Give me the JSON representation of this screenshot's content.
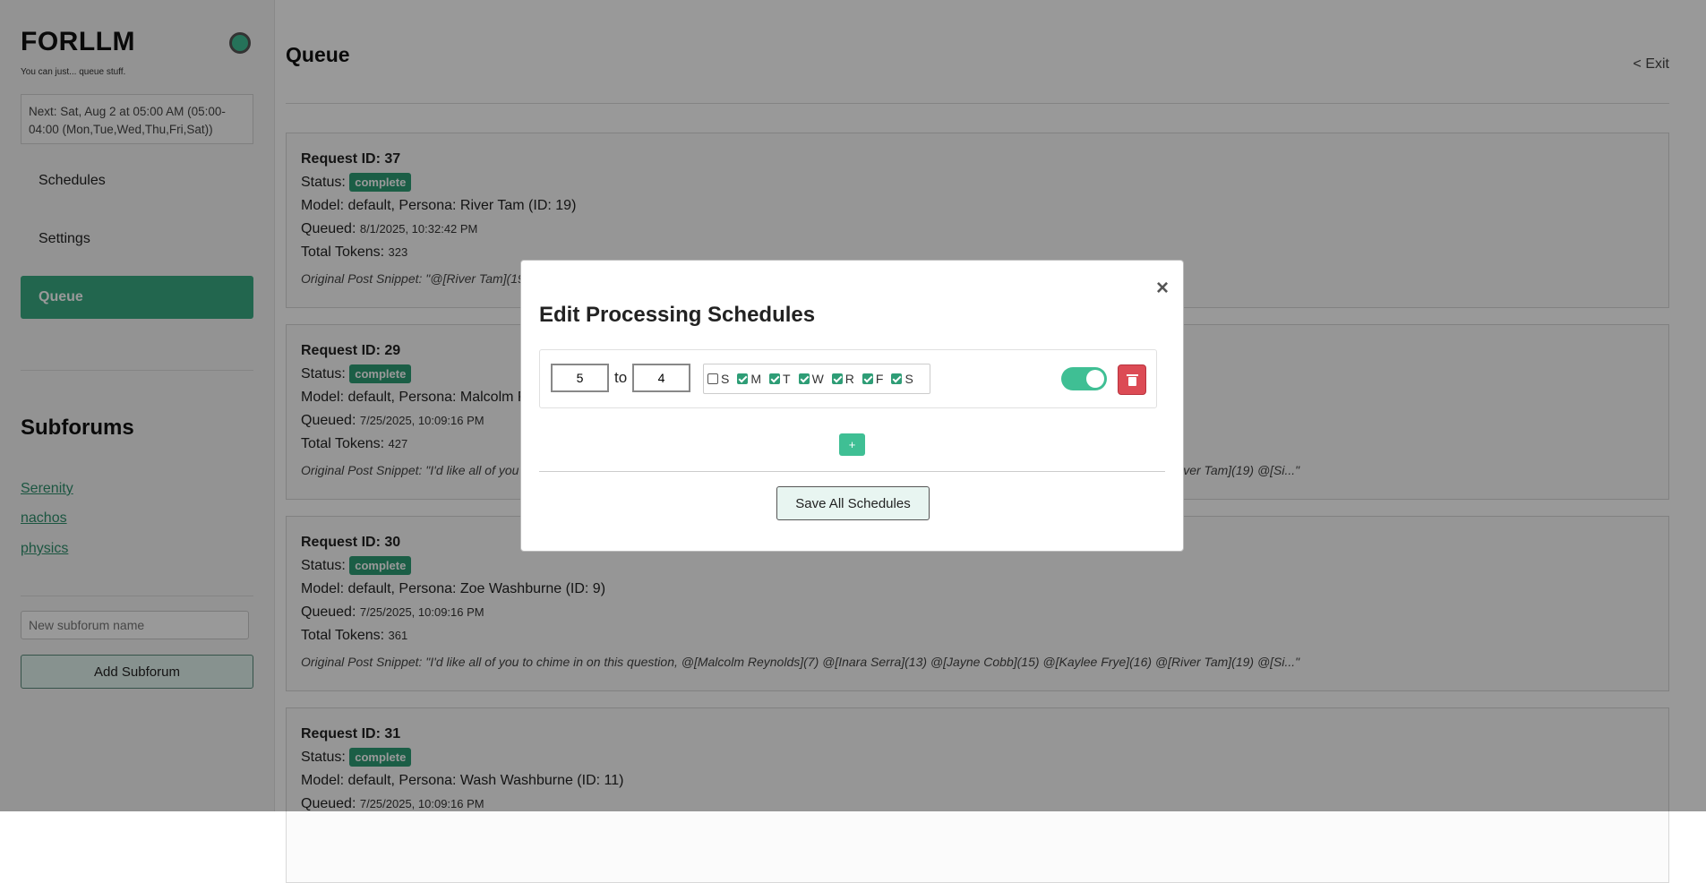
{
  "sidebar": {
    "brand": "FORLLM",
    "tagline": "You can just... queue stuff.",
    "next_run": "Next: Sat, Aug 2 at 05:00 AM (05:00-04:00 (Mon,Tue,Wed,Thu,Fri,Sat))",
    "nav": {
      "schedules": "Schedules",
      "settings": "Settings",
      "queue": "Queue"
    },
    "subforums_heading": "Subforums",
    "subforums": [
      "Serenity",
      "nachos",
      "physics"
    ],
    "new_subforum_placeholder": "New subforum name",
    "add_subforum_label": "Add Subforum"
  },
  "main": {
    "title": "Queue",
    "exit_label": "< Exit",
    "labels": {
      "status": "Status:",
      "queued": "Queued:",
      "tokens": "Total Tokens:"
    },
    "requests": [
      {
        "id_line": "Request ID: 37",
        "status": "complete",
        "model_line": "Model: default, Persona: River Tam (ID: 19)",
        "queued": "8/1/2025, 10:32:42 PM",
        "tokens": "323",
        "snippet": "Original Post Snippet: \"@[River Tam](19"
      },
      {
        "id_line": "Request ID: 29",
        "status": "complete",
        "model_line": "Model: default, Persona: Malcolm R",
        "queued": "7/25/2025, 10:09:16 PM",
        "tokens": "427",
        "snippet": "Original Post Snippet: \"I'd like all of you to chime in on this question, @[Malcolm Reynolds](7) @[Inara Serra](13) @[Jayne Cobb](15) @[Kaylee Frye](16) @[River Tam](19) @[Si...\""
      },
      {
        "id_line": "Request ID: 30",
        "status": "complete",
        "model_line": "Model: default, Persona: Zoe Washburne (ID: 9)",
        "queued": "7/25/2025, 10:09:16 PM",
        "tokens": "361",
        "snippet": "Original Post Snippet: \"I'd like all of you to chime in on this question, @[Malcolm Reynolds](7) @[Inara Serra](13) @[Jayne Cobb](15) @[Kaylee Frye](16) @[River Tam](19) @[Si...\""
      },
      {
        "id_line": "Request ID: 31",
        "status": "complete",
        "model_line": "Model: default, Persona: Wash Washburne (ID: 11)",
        "queued": "7/25/2025, 10:09:16 PM",
        "tokens": "",
        "snippet": ""
      }
    ]
  },
  "modal": {
    "title": "Edit Processing Schedules",
    "close_symbol": "×",
    "schedule": {
      "start_hour": "5",
      "to_label": "to",
      "end_hour": "4",
      "days": [
        {
          "letter": "S",
          "checked": false
        },
        {
          "letter": "M",
          "checked": true
        },
        {
          "letter": "T",
          "checked": true
        },
        {
          "letter": "W",
          "checked": true
        },
        {
          "letter": "R",
          "checked": true
        },
        {
          "letter": "F",
          "checked": true
        },
        {
          "letter": "S",
          "checked": true
        }
      ],
      "enabled": true,
      "delete_icon": "trash-icon"
    },
    "add_label": "+",
    "save_label": "Save All Schedules"
  },
  "colors": {
    "accent": "#3aaa82",
    "badge": "#2e9d76",
    "toggle": "#3fbf94",
    "danger": "#dc4b55"
  }
}
